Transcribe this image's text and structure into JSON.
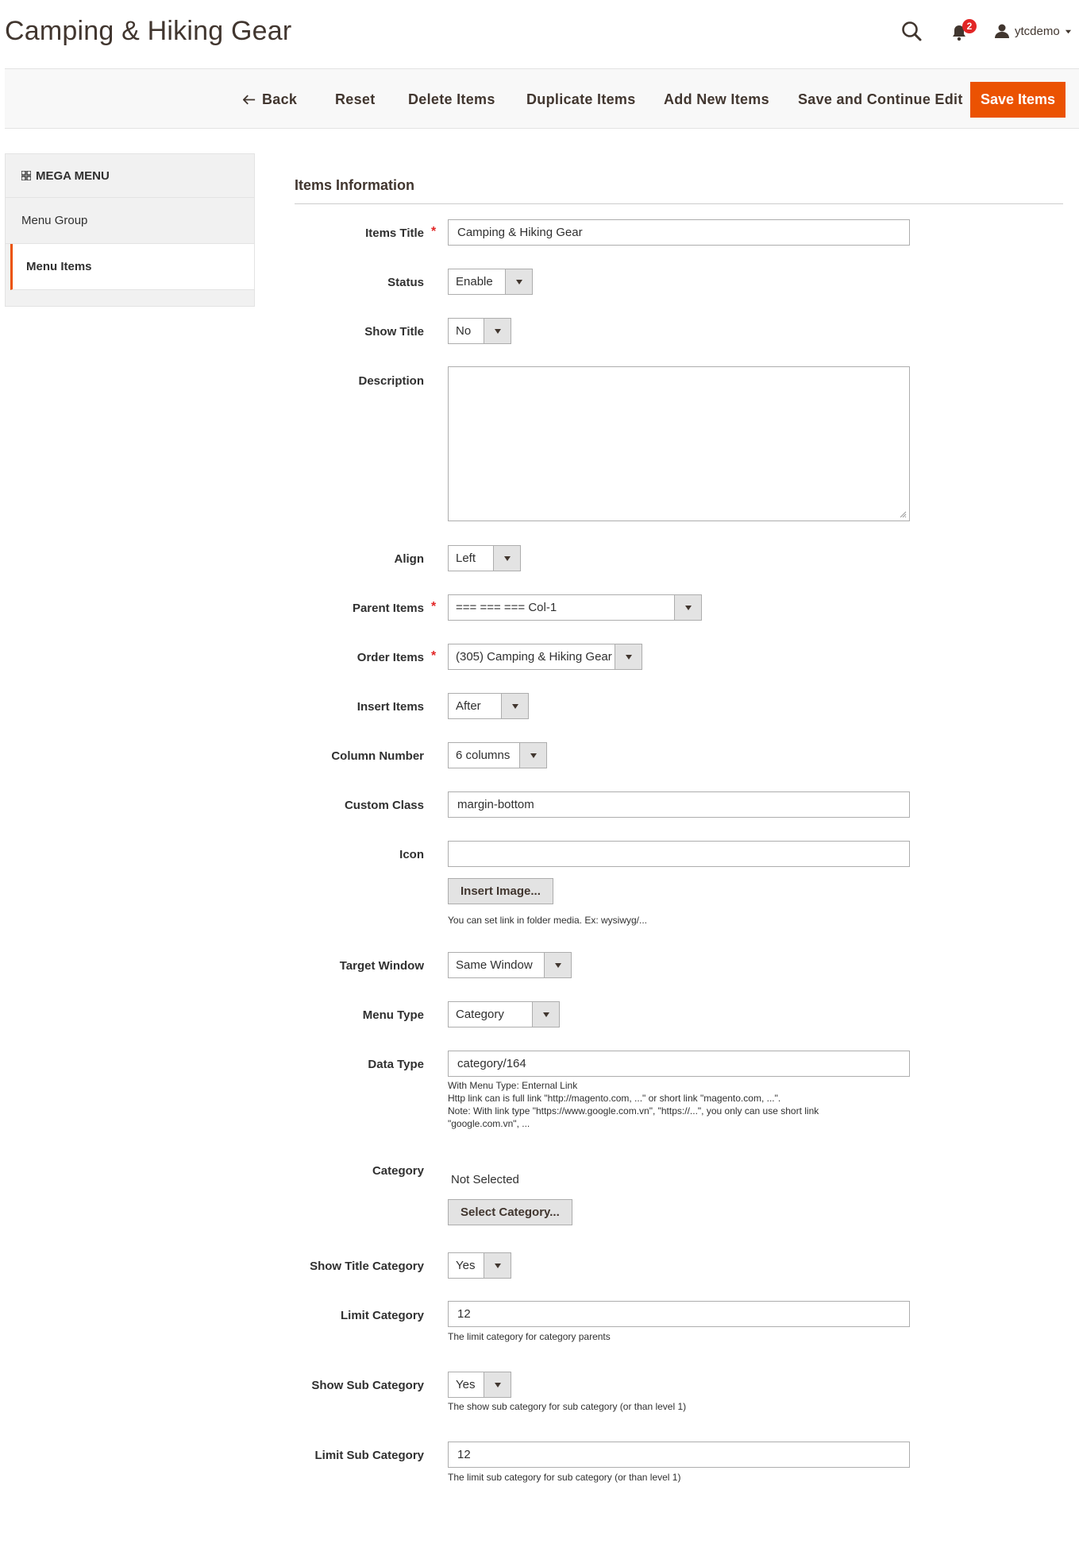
{
  "header": {
    "title": "Camping & Hiking Gear",
    "notifications_count": "2",
    "username": "ytcdemo"
  },
  "toolbar": {
    "back": "Back",
    "reset": "Reset",
    "delete": "Delete Items",
    "duplicate": "Duplicate Items",
    "add_new": "Add New Items",
    "save_continue": "Save and Continue Edit",
    "save": "Save Items"
  },
  "sidebar": {
    "heading": "MEGA MENU",
    "items": [
      {
        "label": "Menu Group"
      },
      {
        "label": "Menu Items"
      }
    ]
  },
  "form": {
    "section_title": "Items Information",
    "items_title": {
      "label": "Items Title",
      "value": "Camping & Hiking Gear"
    },
    "status": {
      "label": "Status",
      "value": "Enable"
    },
    "show_title": {
      "label": "Show Title",
      "value": "No"
    },
    "description": {
      "label": "Description",
      "value": ""
    },
    "align": {
      "label": "Align",
      "value": "Left"
    },
    "parent_items": {
      "label": "Parent Items",
      "value": "=== === === Col-1"
    },
    "order_items": {
      "label": "Order Items",
      "value": "(305) Camping & Hiking Gear"
    },
    "insert_items": {
      "label": "Insert Items",
      "value": "After"
    },
    "column_number": {
      "label": "Column Number",
      "value": "6 columns"
    },
    "custom_class": {
      "label": "Custom Class",
      "value": "margin-bottom"
    },
    "icon": {
      "label": "Icon",
      "value": "",
      "button": "Insert Image...",
      "note": "You can set link in folder media. Ex: wysiwyg/..."
    },
    "target_window": {
      "label": "Target Window",
      "value": "Same Window"
    },
    "menu_type": {
      "label": "Menu Type",
      "value": "Category"
    },
    "data_type": {
      "label": "Data Type",
      "value": "category/164",
      "note_1": "With Menu Type: Enternal Link",
      "note_2": "Http link can is full link \"http://magento.com, ...\" or short link \"magento.com, ...\".",
      "note_3": "Note: With link type \"https://www.google.com.vn\", \"https://...\", you only can use short link",
      "note_4": "\"google.com.vn\", ..."
    },
    "category": {
      "label": "Category",
      "value": "Not Selected",
      "button": "Select Category..."
    },
    "show_title_category": {
      "label": "Show Title Category",
      "value": "Yes"
    },
    "limit_category": {
      "label": "Limit Category",
      "value": "12",
      "note": "The limit category for category parents"
    },
    "show_sub_category": {
      "label": "Show Sub Category",
      "value": "Yes",
      "note": "The show sub category for sub category (or than level 1)"
    },
    "limit_sub_category": {
      "label": "Limit Sub Category",
      "value": "12",
      "note": "The limit sub category for sub category (or than level 1)"
    }
  },
  "colors": {
    "accent": "#eb5202",
    "badge": "#e22626",
    "text": "#303030"
  }
}
